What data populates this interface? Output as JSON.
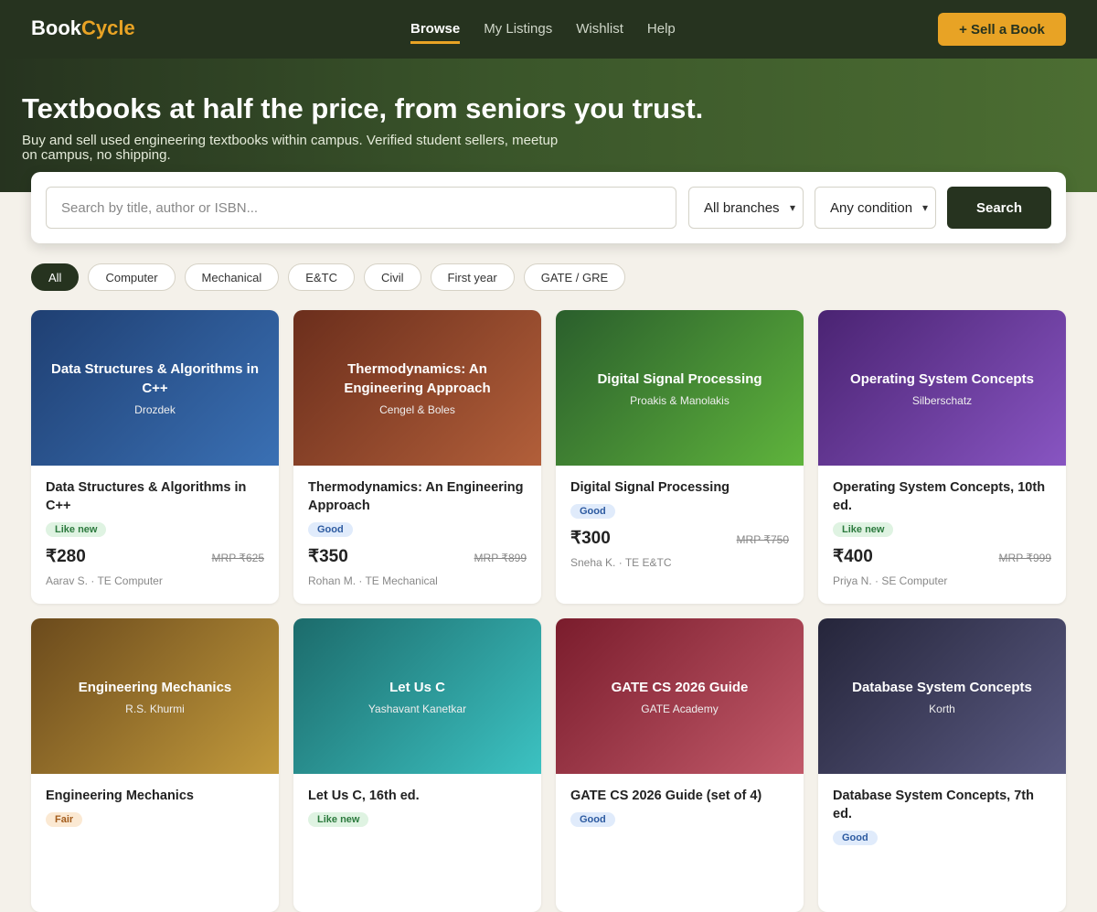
{
  "header": {
    "logo_prefix": "Book",
    "logo_suffix": "Cycle",
    "nav": [
      "Browse",
      "My Listings",
      "Wishlist",
      "Help"
    ],
    "sell_label": "+ Sell a Book"
  },
  "hero": {
    "title": "Textbooks at half the price, from seniors you trust.",
    "subtitle": "Buy and sell used engineering textbooks within campus. Verified student sellers, meetup on campus, no shipping."
  },
  "search": {
    "placeholder": "Search by title, author or ISBN...",
    "branch": "All branches",
    "condition": "Any condition",
    "button": "Search"
  },
  "chips": [
    "All",
    "Computer",
    "Mechanical",
    "E&TC",
    "Civil",
    "First year",
    "GATE / GRE"
  ],
  "books": [
    {
      "cover_title": "Data Structures & Algorithms in C++",
      "cover_author": "Drozdek",
      "title": "Data Structures & Algorithms in C++",
      "condition": "Like new",
      "price": "₹280",
      "mrp": "MRP ₹625",
      "seller": "Aarav S. · TE Computer",
      "color_a": "#1f3f72",
      "color_b": "#3a70b4"
    },
    {
      "cover_title": "Thermodynamics: An Engineering Approach",
      "cover_author": "Cengel & Boles",
      "title": "Thermodynamics: An Engineering Approach",
      "condition": "Good",
      "price": "₹350",
      "mrp": "MRP ₹899",
      "seller": "Rohan M. · TE Mechanical",
      "color_a": "#6b2e1c",
      "color_b": "#b25f3a"
    },
    {
      "cover_title": "Digital Signal Processing",
      "cover_author": "Proakis & Manolakis",
      "title": "Digital Signal Processing",
      "condition": "Good",
      "price": "₹300",
      "mrp": "MRP ₹750",
      "seller": "Sneha K. · TE E&TC",
      "color_a": "#2a5e2c",
      "color_b": "#5fb43c"
    },
    {
      "cover_title": "Operating System Concepts",
      "cover_author": "Silberschatz",
      "title": "Operating System Concepts, 10th ed.",
      "condition": "Like new",
      "price": "₹400",
      "mrp": "MRP ₹999",
      "seller": "Priya N. · SE Computer",
      "color_a": "#4a2372",
      "color_b": "#8855c2"
    },
    {
      "cover_title": "Engineering Mechanics",
      "cover_author": "R.S. Khurmi",
      "title": "Engineering Mechanics",
      "condition": "Fair",
      "price": "",
      "mrp": "",
      "seller": "",
      "color_a": "#6b4a1c",
      "color_b": "#c29a3c"
    },
    {
      "cover_title": "Let Us C",
      "cover_author": "Yashavant Kanetkar",
      "title": "Let Us C, 16th ed.",
      "condition": "Like new",
      "price": "",
      "mrp": "",
      "seller": "",
      "color_a": "#1c6b6b",
      "color_b": "#3cc2c2"
    },
    {
      "cover_title": "GATE CS 2026 Guide",
      "cover_author": "GATE Academy",
      "title": "GATE CS 2026 Guide (set of 4)",
      "condition": "Good",
      "price": "",
      "mrp": "",
      "seller": "",
      "color_a": "#7a1c2c",
      "color_b": "#c25a6a"
    },
    {
      "cover_title": "Database System Concepts",
      "cover_author": "Korth",
      "title": "Database System Concepts, 7th ed.",
      "condition": "Good",
      "price": "",
      "mrp": "",
      "seller": "",
      "color_a": "#25253a",
      "color_b": "#5a5a82"
    }
  ]
}
